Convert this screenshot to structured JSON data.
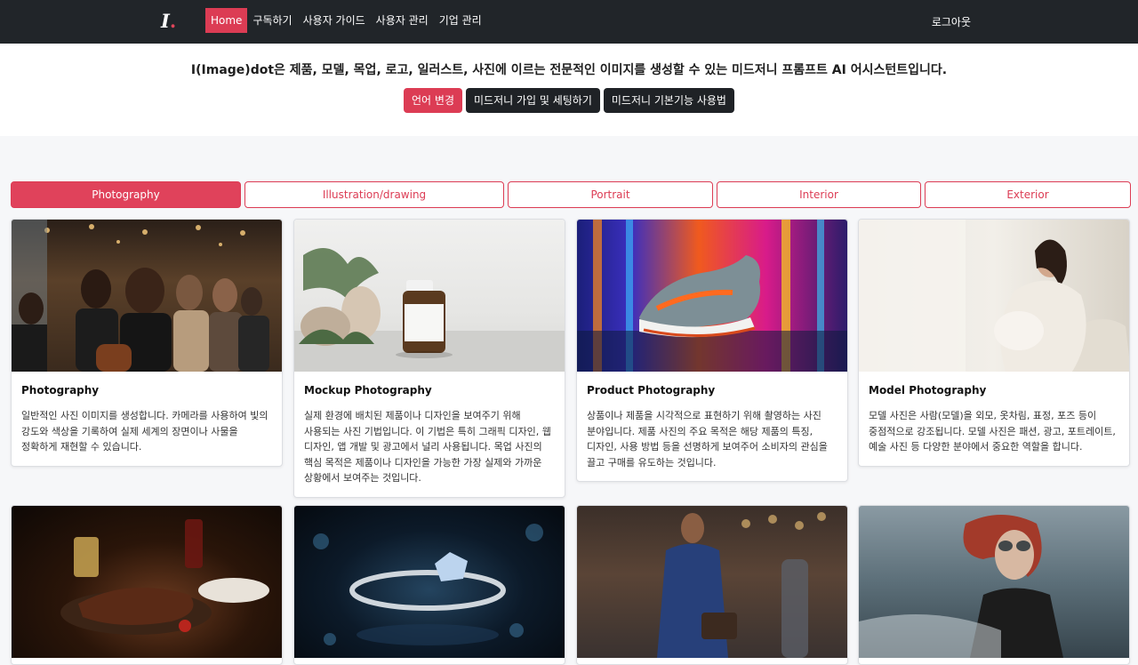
{
  "nav": {
    "logo_text": "I",
    "logo_dot": ".",
    "items": [
      {
        "label": "Home",
        "active": true
      },
      {
        "label": "구독하기"
      },
      {
        "label": "사용자 가이드"
      },
      {
        "label": "사용자 관리"
      },
      {
        "label": "기업 관리"
      }
    ],
    "logout": "로그아웃"
  },
  "hero": {
    "title": "I(Image)dot은 제품, 모델, 목업, 로고, 일러스트, 사진에 이르는 전문적인 이미지를 생성할 수 있는 미드저니 프롬프트 AI 어시스턴트입니다.",
    "buttons": [
      "언어 변경",
      "미드저니 가입 및 세팅하기",
      "미드저니 기본기능 사용법"
    ]
  },
  "tabs": [
    "Photography",
    "Illustration/drawing",
    "Portrait",
    "Interior",
    "Exterior"
  ],
  "cards": [
    {
      "title": "Photography",
      "text": "일반적인 사진 이미지를 생성합니다. 카메라를 사용하여 빛의 강도와 색상을 기록하여 실제 세계의 장면이나 사물을 정확하게 재현할 수 있습니다."
    },
    {
      "title": "Mockup Photography",
      "text": "실제 환경에 배치된 제품이나 디자인을 보여주기 위해 사용되는 사진 기법입니다. 이 기법은 특히 그래픽 디자인, 웹 디자인, 앱 개발 및 광고에서 널리 사용됩니다. 목업 사진의 핵심 목적은 제품이나 디자인을 가능한 가장 실제와 가까운 상황에서 보여주는 것입니다."
    },
    {
      "title": "Product Photography",
      "text": "상품이나 제품을 시각적으로 표현하기 위해 촬영하는 사진 분야입니다. 제품 사진의 주요 목적은 해당 제품의 특징, 디자인, 사용 방법 등을 선명하게 보여주어 소비자의 관심을 끌고 구매를 유도하는 것입니다."
    },
    {
      "title": "Model Photography",
      "text": "모델 사진은 사람(모델)을 외모, 옷차림, 표정, 포즈 등이 중점적으로 강조됩니다. 모델 사진은 패션, 광고, 포트레이트, 예술 사진 등 다양한 분야에서 중요한 역할을 합니다."
    }
  ],
  "colors": {
    "accent": "#dc3c54",
    "navbar": "#212529"
  }
}
